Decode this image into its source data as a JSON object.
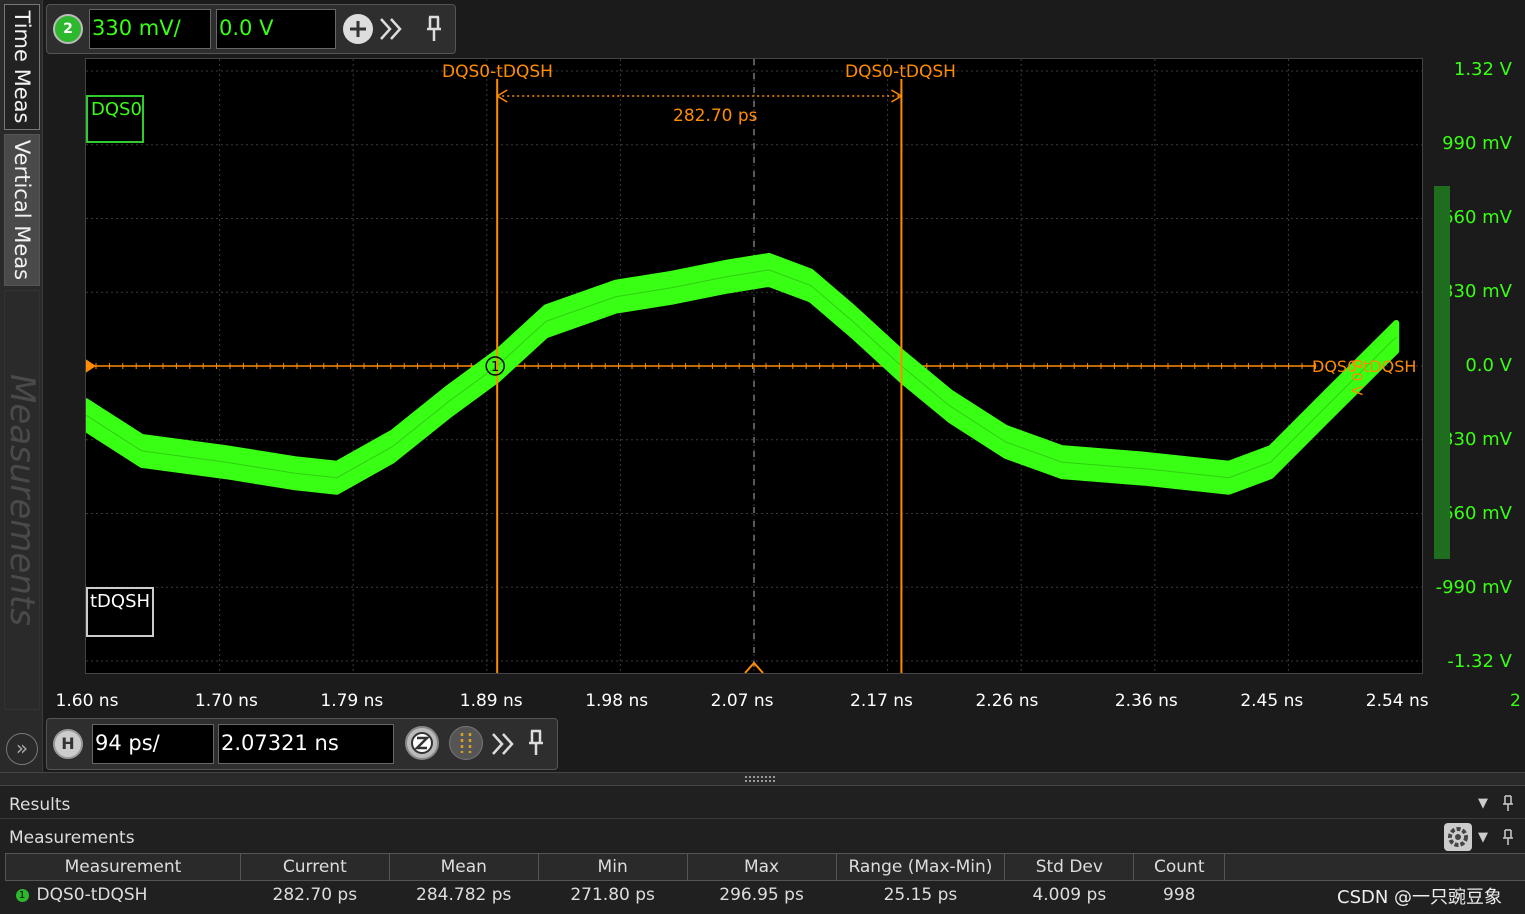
{
  "sidebar": {
    "tabs": [
      "Time Meas",
      "Vertical Meas",
      "Measurements"
    ]
  },
  "channel_toolbar": {
    "channel_number": "2",
    "scale": "330 mV/",
    "offset": "0.0 V"
  },
  "plot": {
    "channel_label": "DQS0",
    "measurement_label": "tDQSH",
    "cursor_1_label": "DQS0-tDQSH",
    "cursor_2_label": "DQS0-tDQSH",
    "delta_label": "282.70 ps",
    "cursor_marker": "1",
    "right_marker_text": "DQS0-tDQSH",
    "right_marker_level": "0.0 V",
    "y_labels": [
      "1.32 V",
      "990 mV",
      "660 mV",
      "330 mV",
      "0.0 V",
      "-330 mV",
      "-660 mV",
      "-990 mV",
      "-1.32 V"
    ],
    "x_labels": [
      "1.60 ns",
      "1.70 ns",
      "1.79 ns",
      "1.89 ns",
      "1.98 ns",
      "2.07 ns",
      "2.17 ns",
      "2.26 ns",
      "2.36 ns",
      "2.45 ns",
      "2.54 ns"
    ],
    "x_overflow": "2",
    "trace_color": "#39ff14",
    "cursor_color": "#ff8c00"
  },
  "chart_data": {
    "type": "line",
    "series": [
      {
        "name": "DQS0",
        "x_ns": [
          1.6,
          1.64,
          1.7,
          1.75,
          1.78,
          1.82,
          1.86,
          1.895,
          1.93,
          1.98,
          2.02,
          2.06,
          2.09,
          2.12,
          2.15,
          2.185,
          2.22,
          2.26,
          2.3,
          2.36,
          2.42,
          2.45,
          2.49,
          2.54
        ],
        "y_mV": [
          -220,
          -380,
          -430,
          -480,
          -500,
          -360,
          -160,
          0,
          200,
          310,
          350,
          400,
          430,
          360,
          200,
          0,
          -180,
          -340,
          -430,
          -460,
          -500,
          -430,
          -180,
          130
        ]
      }
    ],
    "cursors": {
      "x1_ns": 1.895,
      "x2_ns": 2.185,
      "delta": "282.70 ps"
    },
    "xlim_ns": [
      1.6,
      2.5585
    ],
    "ylim_mV": [
      -1320,
      1320
    ],
    "grid": true
  },
  "timebase_toolbar": {
    "badge": "H",
    "scale": "94 ps/",
    "position": "2.07321 ns"
  },
  "results": {
    "title": "Results",
    "subtitle": "Measurements",
    "columns": [
      "Measurement",
      "Current",
      "Mean",
      "Min",
      "Max",
      "Range (Max-Min)",
      "Std Dev",
      "Count"
    ],
    "rows": [
      {
        "name": "DQS0-tDQSH",
        "current": "282.70 ps",
        "mean": "284.782 ps",
        "min": "271.80 ps",
        "max": "296.95 ps",
        "range": "25.15 ps",
        "stddev": "4.009 ps",
        "count": "998"
      }
    ],
    "row_indicator": "1"
  },
  "watermark": "CSDN @一只豌豆象"
}
